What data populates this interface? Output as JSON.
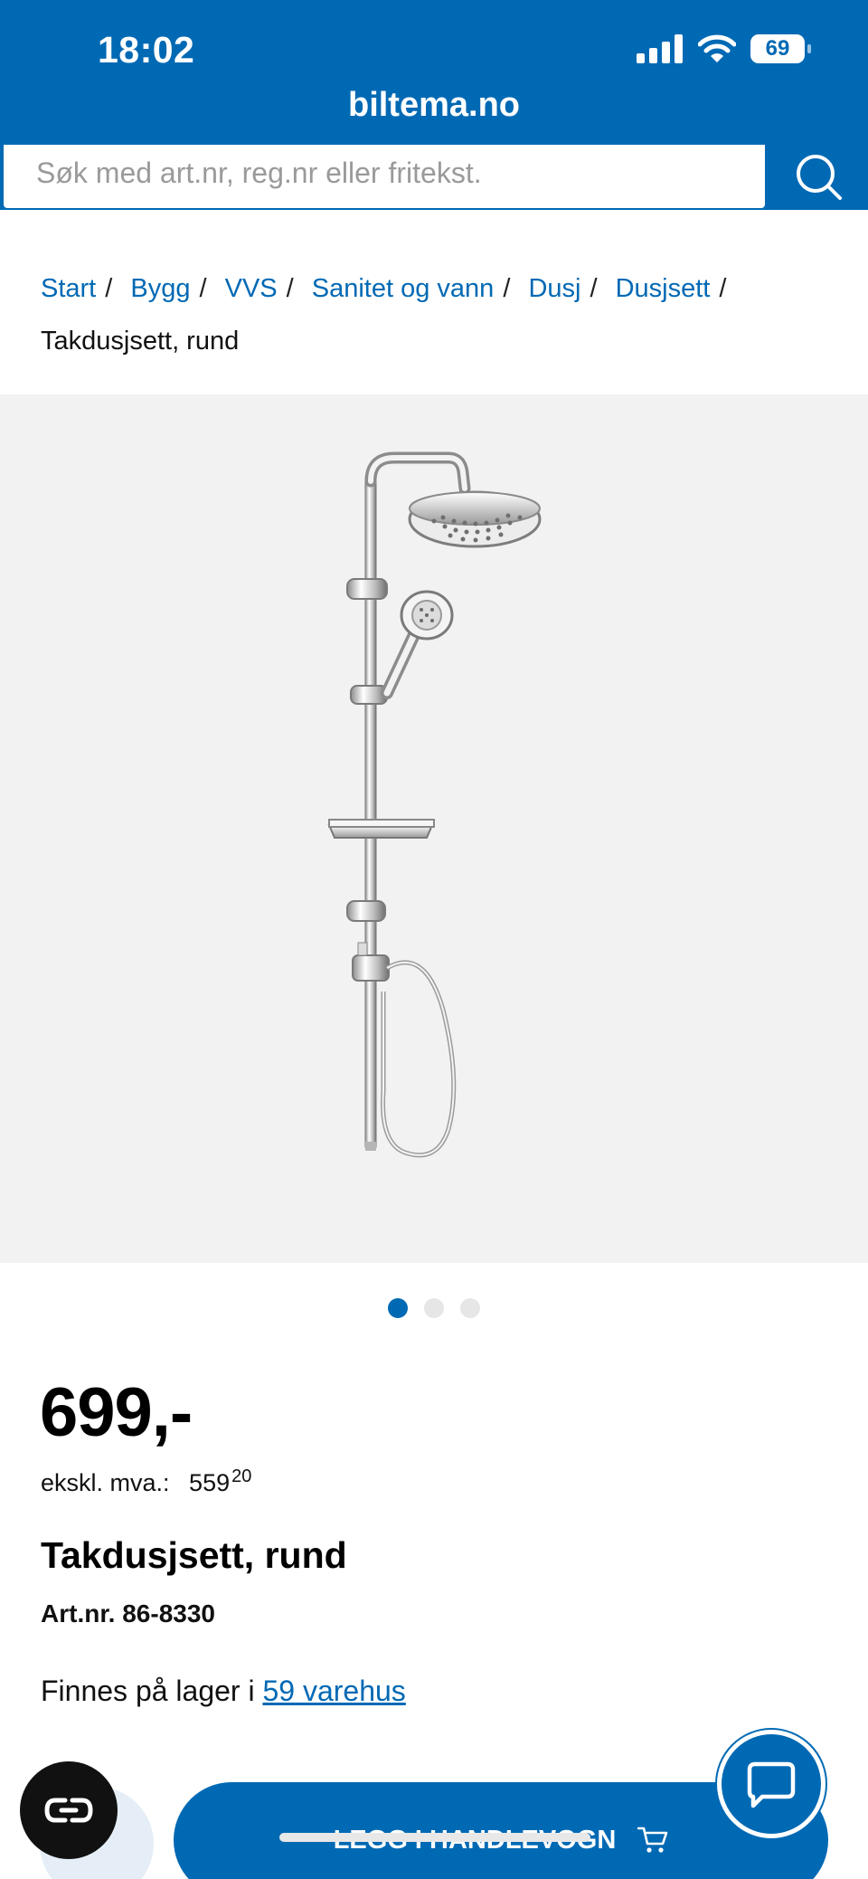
{
  "status_bar": {
    "time": "18:02",
    "battery": "69"
  },
  "browser": {
    "url": "biltema.no"
  },
  "search": {
    "placeholder": "Søk med art.nr, reg.nr eller fritekst."
  },
  "breadcrumb": {
    "links": [
      "Start",
      "Bygg",
      "VVS",
      "Sanitet og vann",
      "Dusj",
      "Dusjsett"
    ],
    "separator": "/",
    "current": "Takdusjsett, rund"
  },
  "gallery": {
    "image_count": 3,
    "active_index": 0
  },
  "product": {
    "price": "699,-",
    "ex_vat_label": "ekskl. mva.:",
    "ex_vat_whole": "559",
    "ex_vat_decimals": "20",
    "title": "Takdusjsett, rund",
    "art_nr": "Art.nr. 86-8330",
    "stock_prefix": "Finnes på lager i",
    "stock_link": "59 varehus"
  },
  "actions": {
    "add_to_cart_label": "LEGG I HANDLEVOGN"
  },
  "colors": {
    "brand_blue": "#0069b4",
    "image_bg": "#f2f2f2",
    "inactive_dot": "#e6e6e6"
  },
  "icons": [
    "signal-icon",
    "wifi-icon",
    "battery-icon",
    "search-icon",
    "cart-icon",
    "chat-icon",
    "scan-icon"
  ]
}
